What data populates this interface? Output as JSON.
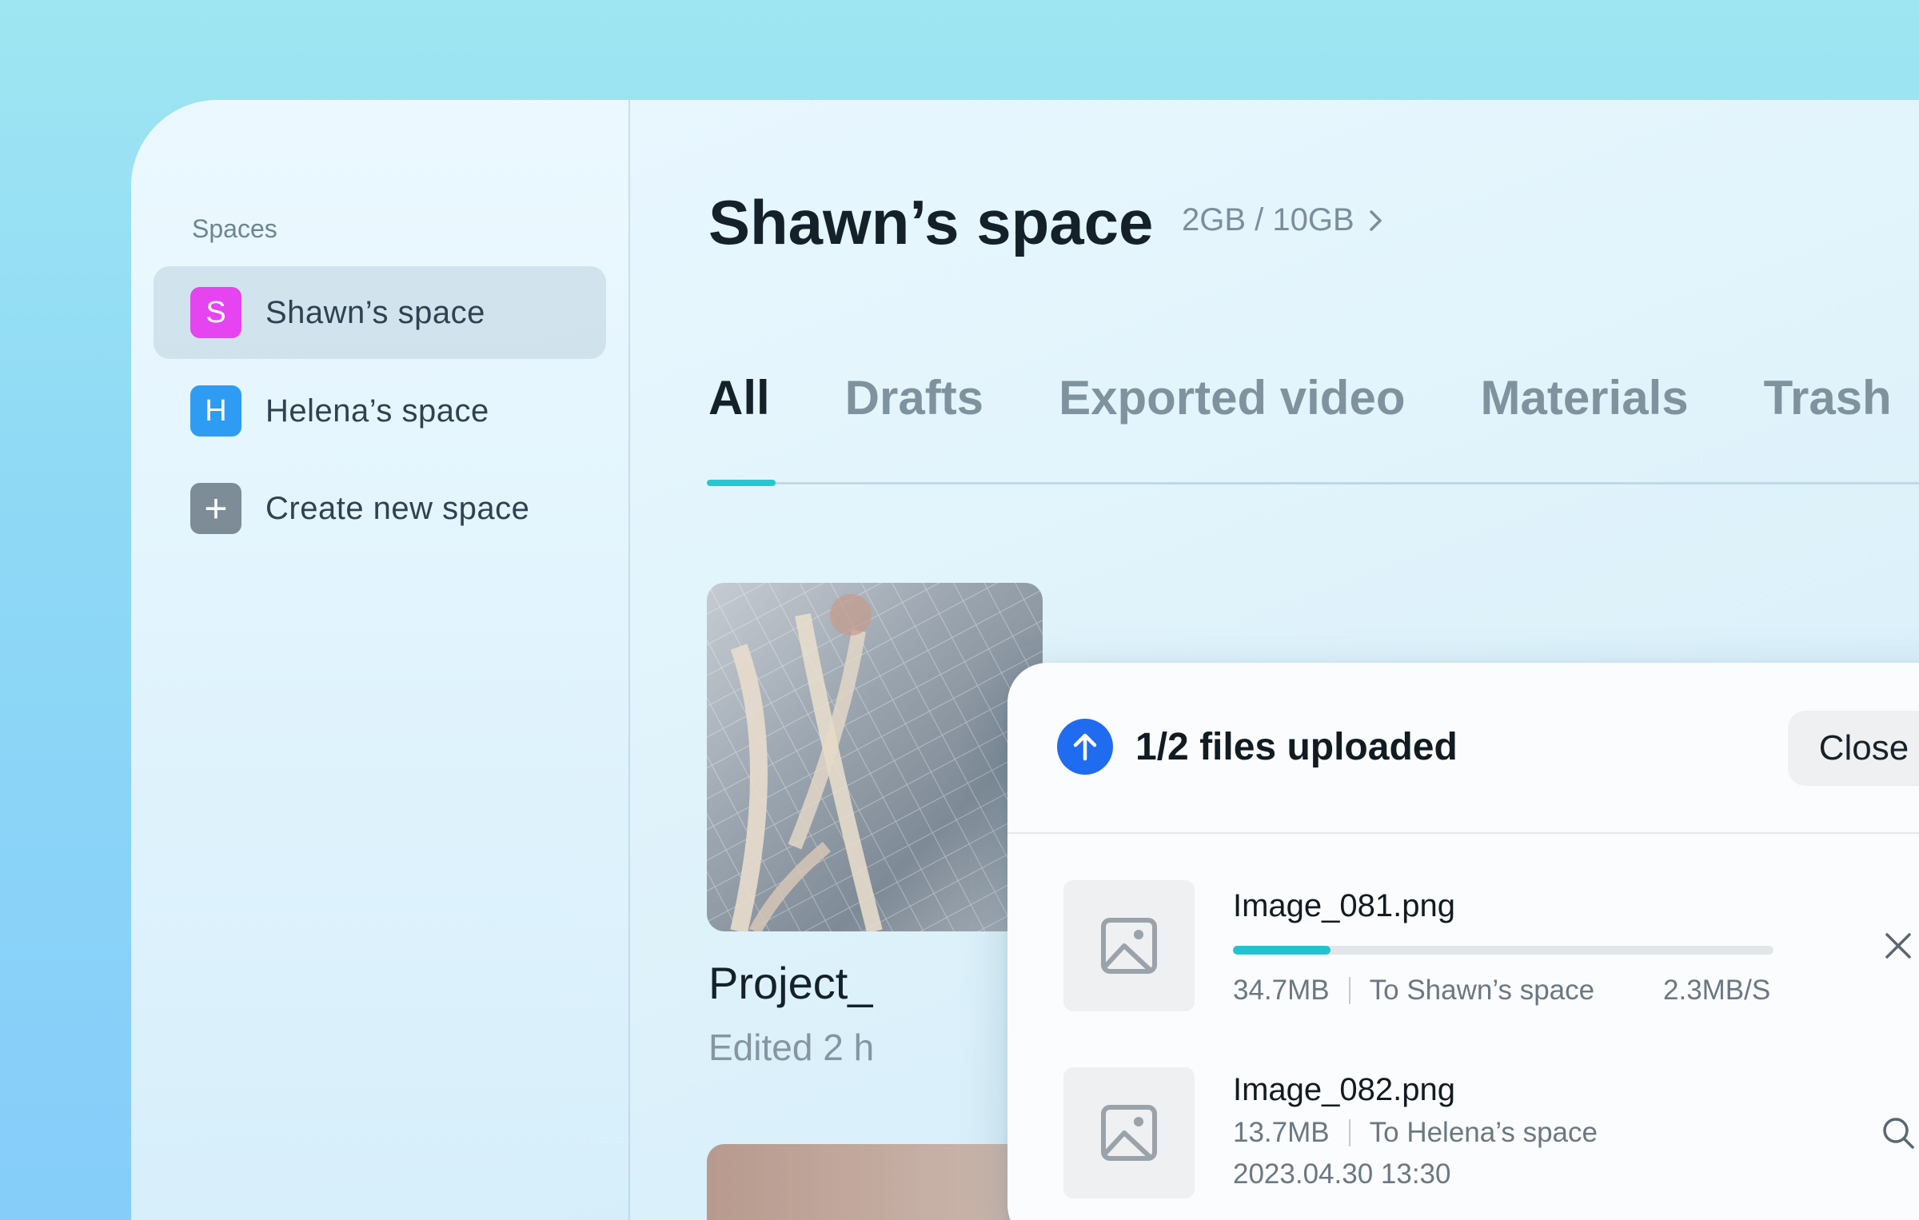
{
  "sidebar": {
    "heading": "Spaces",
    "items": [
      {
        "badge": "S",
        "label": "Shawn’s space",
        "color": "#e544f0",
        "active": true
      },
      {
        "badge": "H",
        "label": "Helena’s space",
        "color": "#2f9cf4",
        "active": false
      },
      {
        "badge": "+",
        "label": "Create new space",
        "color": "#7d8c97",
        "active": false
      }
    ]
  },
  "header": {
    "title": "Shawn’s space",
    "storage": "2GB / 10GB"
  },
  "tabs": [
    "All",
    "Drafts",
    "Exported video",
    "Materials",
    "Trash"
  ],
  "project": {
    "title": "Project_",
    "subtitle": "Edited 2 h"
  },
  "upload": {
    "title": "1/2 files uploaded",
    "close_label": "Close",
    "files": [
      {
        "name": "Image_081.png",
        "size": "34.7MB",
        "destination": "To Shawn’s space",
        "speed": "2.3MB/S",
        "progress": 0.18,
        "action_icon": "close-icon"
      },
      {
        "name": "Image_082.png",
        "size": "13.7MB",
        "destination": "To Helena’s space",
        "timestamp": "2023.04.30 13:30",
        "action_icon": "search-icon"
      }
    ]
  },
  "colors": {
    "accent": "#28c6d2",
    "upload_icon": "#1f6cf0"
  }
}
